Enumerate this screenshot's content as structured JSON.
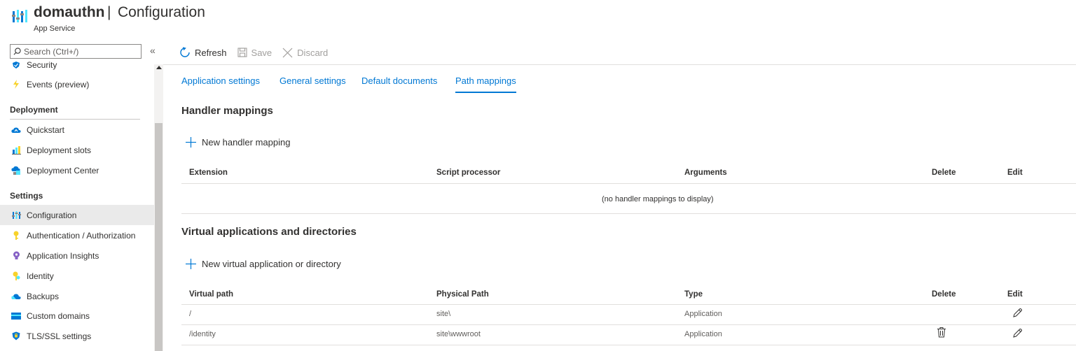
{
  "header": {
    "app_name": "domauthn",
    "separator": "|",
    "page_title": "Configuration",
    "subtitle": "App Service"
  },
  "sidebar": {
    "search_placeholder": "Search (Ctrl+/)",
    "collapse_glyph": "«",
    "items_top": [
      {
        "label": "Security",
        "icon": "shield-icon"
      },
      {
        "label": "Events (preview)",
        "icon": "lightning-icon"
      }
    ],
    "groups": [
      {
        "label": "Deployment",
        "items": [
          {
            "label": "Quickstart",
            "icon": "cloud-quickstart-icon"
          },
          {
            "label": "Deployment slots",
            "icon": "deployment-slots-icon"
          },
          {
            "label": "Deployment Center",
            "icon": "deployment-center-icon"
          }
        ]
      },
      {
        "label": "Settings",
        "items": [
          {
            "label": "Configuration",
            "icon": "configuration-icon",
            "active": true
          },
          {
            "label": "Authentication / Authorization",
            "icon": "key-icon"
          },
          {
            "label": "Application Insights",
            "icon": "lightbulb-icon"
          },
          {
            "label": "Identity",
            "icon": "identity-key-icon"
          },
          {
            "label": "Backups",
            "icon": "cloud-backup-icon"
          },
          {
            "label": "Custom domains",
            "icon": "domain-icon"
          },
          {
            "label": "TLS/SSL settings",
            "icon": "shield-lock-icon"
          }
        ]
      }
    ]
  },
  "toolbar": {
    "refresh_label": "Refresh",
    "save_label": "Save",
    "discard_label": "Discard"
  },
  "tabs": [
    {
      "label": "Application settings"
    },
    {
      "label": "General settings"
    },
    {
      "label": "Default documents"
    },
    {
      "label": "Path mappings",
      "active": true
    }
  ],
  "handler_mappings": {
    "title": "Handler mappings",
    "add_label": "New handler mapping",
    "columns": [
      "Extension",
      "Script processor",
      "Arguments",
      "Delete",
      "Edit"
    ],
    "empty_message": "(no handler mappings to display)"
  },
  "virtual_apps": {
    "title": "Virtual applications and directories",
    "add_label": "New virtual application or directory",
    "columns": [
      "Virtual path",
      "Physical Path",
      "Type",
      "Delete",
      "Edit"
    ],
    "rows": [
      {
        "virtual_path": "/",
        "physical_path": "site\\",
        "type": "Application",
        "deletable": false
      },
      {
        "virtual_path": "/identity",
        "physical_path": "site\\wwwroot",
        "type": "Application",
        "deletable": true
      }
    ]
  },
  "colors": {
    "accent": "#0078d4",
    "text": "#323130",
    "muted": "#605e5c",
    "disabled": "#a19f9d"
  }
}
